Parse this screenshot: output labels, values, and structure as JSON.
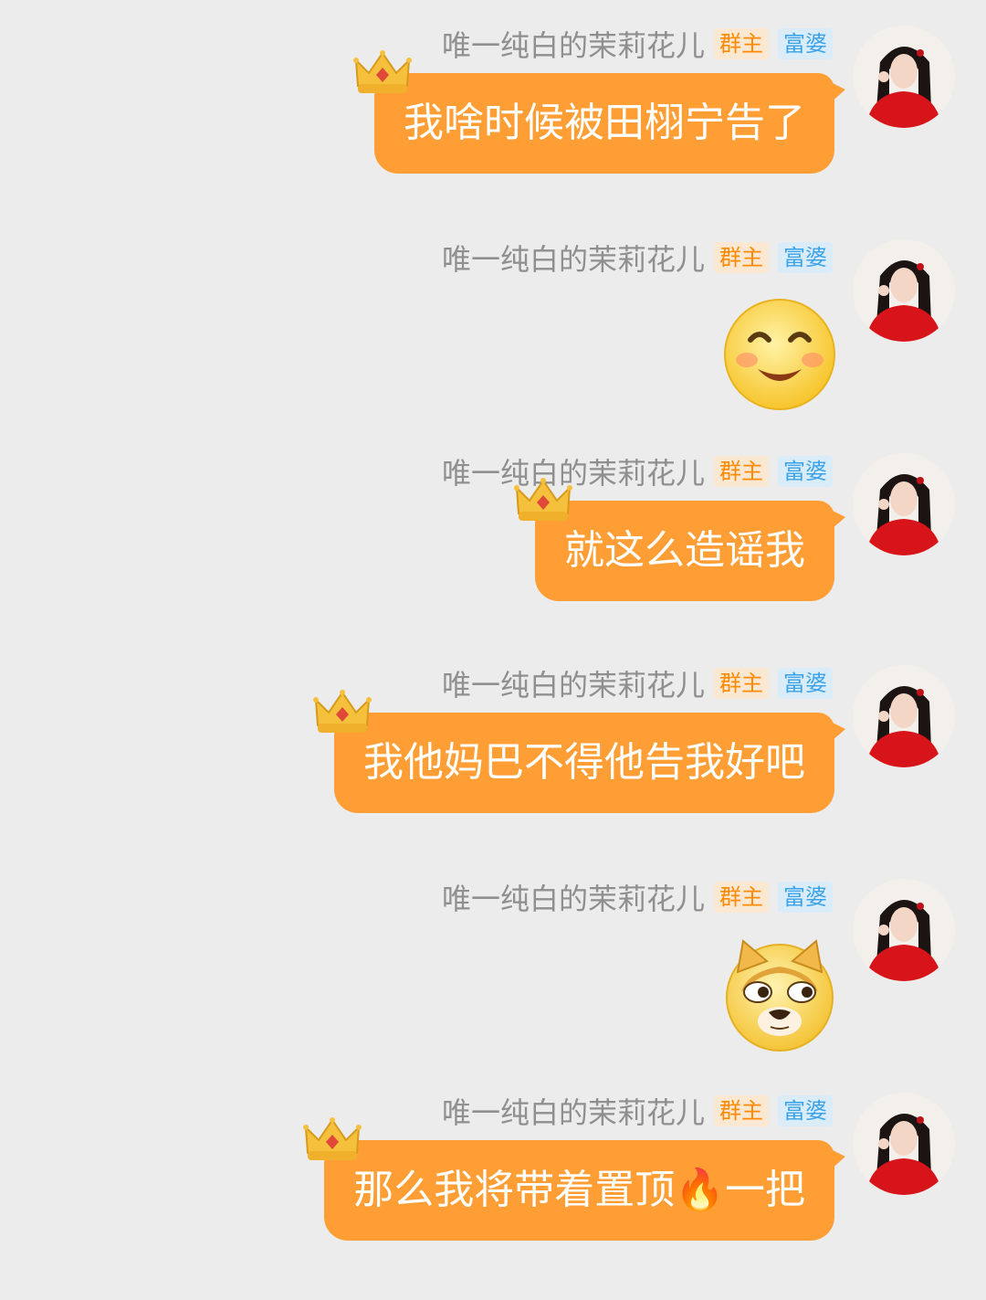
{
  "messages": [
    {
      "sender": "唯一纯白的茉莉花儿",
      "badge_owner": "群主",
      "badge_rich": "富婆",
      "text": "我啥时候被田栩宁告了"
    },
    {
      "sender": "唯一纯白的茉莉花儿",
      "badge_owner": "群主",
      "badge_rich": "富婆",
      "sticker": "smile-emoji"
    },
    {
      "sender": "唯一纯白的茉莉花儿",
      "badge_owner": "群主",
      "badge_rich": "富婆",
      "text": "就这么造谣我"
    },
    {
      "sender": "唯一纯白的茉莉花儿",
      "badge_owner": "群主",
      "badge_rich": "富婆",
      "text": "我他妈巴不得他告我好吧"
    },
    {
      "sender": "唯一纯白的茉莉花儿",
      "badge_owner": "群主",
      "badge_rich": "富婆",
      "sticker": "doge-emoji"
    },
    {
      "sender": "唯一纯白的茉莉花儿",
      "badge_owner": "群主",
      "badge_rich": "富婆",
      "text": "那么我将带着置顶🔥一把"
    }
  ],
  "colors": {
    "background": "#ececec",
    "bubble": "#ff9e35",
    "owner_badge_text": "#ff8a00",
    "rich_badge_text": "#3aa2e8"
  },
  "icons": [
    "avatar",
    "crown-icon",
    "smile-emoji",
    "doge-emoji",
    "fire-emoji"
  ]
}
